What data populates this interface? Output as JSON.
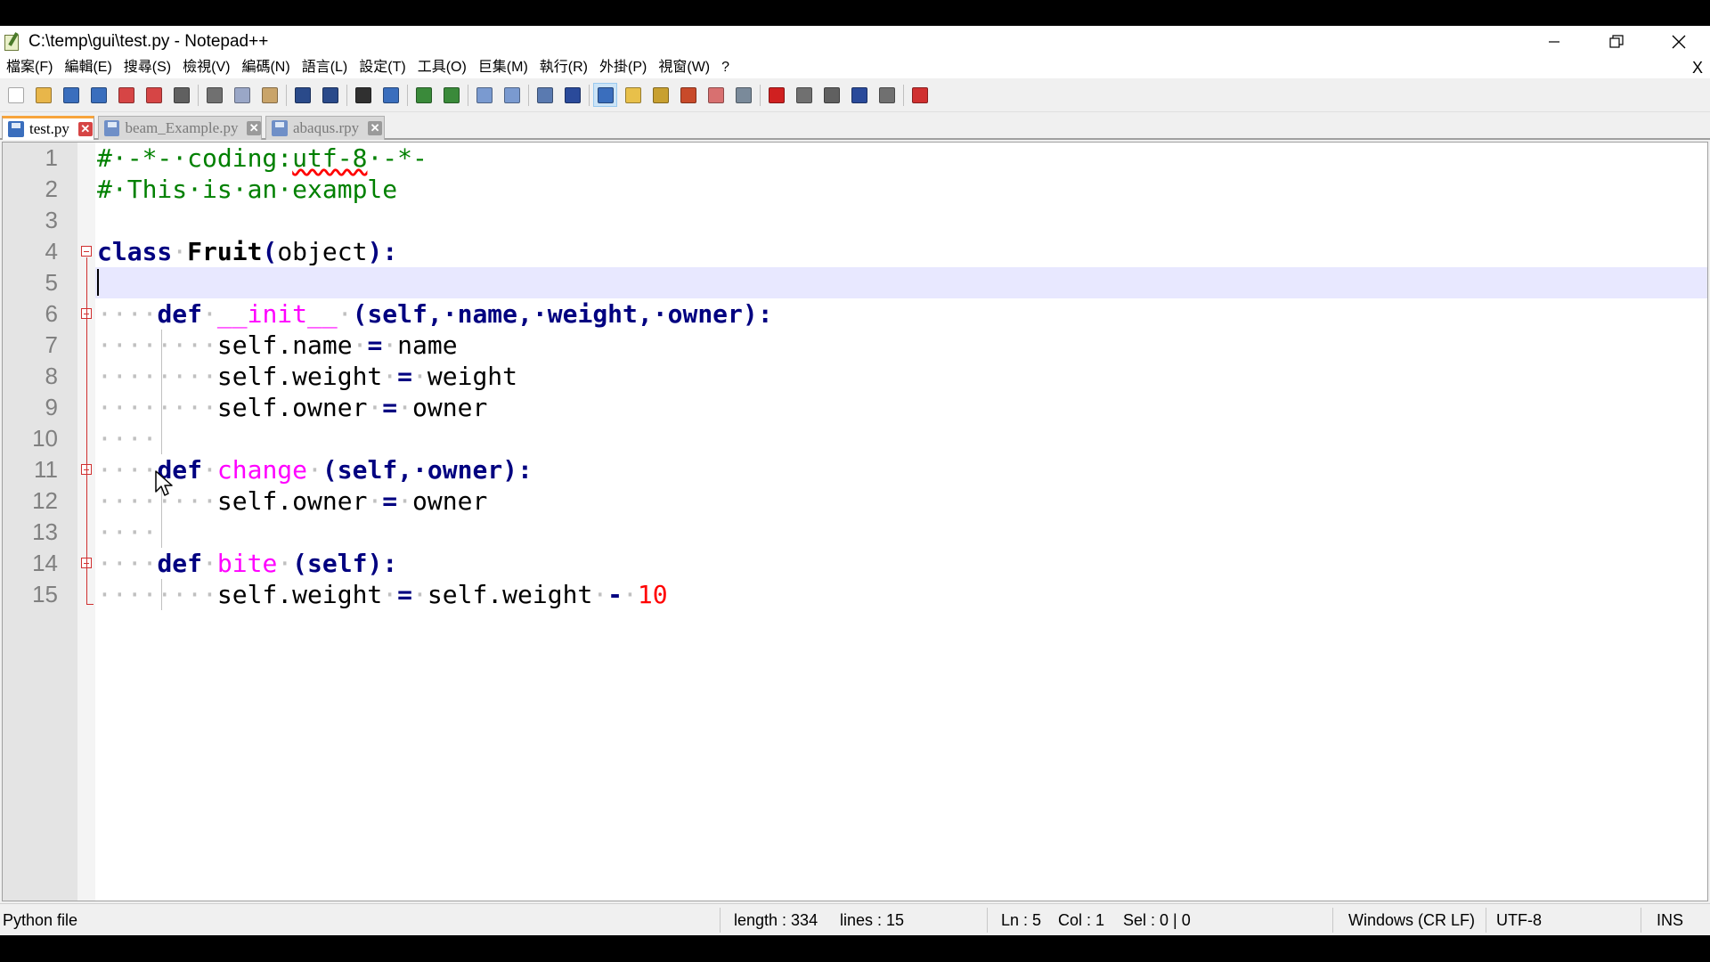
{
  "window": {
    "title": "C:\\temp\\gui\\test.py - Notepad++",
    "controls": [
      "minimize-icon",
      "restore-icon",
      "close-icon"
    ]
  },
  "menu": {
    "items": [
      "檔案(F)",
      "編輯(E)",
      "搜尋(S)",
      "檢視(V)",
      "編碼(N)",
      "語言(L)",
      "設定(T)",
      "工具(O)",
      "巨集(M)",
      "執行(R)",
      "外掛(P)",
      "視窗(W)",
      "?"
    ],
    "close_label": "X"
  },
  "toolbar": {
    "buttons": [
      {
        "icon": "new-file-icon",
        "color": "#ffffff"
      },
      {
        "icon": "open-file-icon",
        "color": "#e8b64a"
      },
      {
        "icon": "save-icon",
        "color": "#3a6ebd"
      },
      {
        "icon": "save-all-icon",
        "color": "#3a6ebd"
      },
      {
        "icon": "close-file-icon",
        "color": "#d64545"
      },
      {
        "icon": "close-all-icon",
        "color": "#d64545"
      },
      {
        "icon": "print-icon",
        "color": "#606060"
      },
      {
        "icon": "cut-icon",
        "color": "#707070"
      },
      {
        "icon": "copy-icon",
        "color": "#9aa7c7"
      },
      {
        "icon": "paste-icon",
        "color": "#c9a46a"
      },
      {
        "icon": "undo-icon",
        "color": "#2a4a8a"
      },
      {
        "icon": "redo-icon",
        "color": "#2a4a8a"
      },
      {
        "icon": "find-icon",
        "color": "#303030"
      },
      {
        "icon": "replace-icon",
        "color": "#3a6ebd"
      },
      {
        "icon": "zoom-in-icon",
        "color": "#3a8a3a"
      },
      {
        "icon": "zoom-out-icon",
        "color": "#3a8a3a"
      },
      {
        "icon": "sync-vertical-icon",
        "color": "#7a9ad0"
      },
      {
        "icon": "sync-horizontal-icon",
        "color": "#7a9ad0"
      },
      {
        "icon": "word-wrap-icon",
        "color": "#5a7ab0"
      },
      {
        "icon": "show-all-chars-icon",
        "color": "#2a4a9a"
      },
      {
        "icon": "indent-guide-icon",
        "color": "#3a6ebd"
      },
      {
        "icon": "user-lang-icon",
        "color": "#e8c04a"
      },
      {
        "icon": "doc-map-icon",
        "color": "#c8a030"
      },
      {
        "icon": "function-list-icon",
        "color": "#c84a2a"
      },
      {
        "icon": "folder-workspace-icon",
        "color": "#d87070"
      },
      {
        "icon": "monitoring-icon",
        "color": "#7a8a9a"
      },
      {
        "icon": "record-macro-icon",
        "color": "#d02020"
      },
      {
        "icon": "stop-macro-icon",
        "color": "#707070"
      },
      {
        "icon": "play-macro-icon",
        "color": "#606060"
      },
      {
        "icon": "run-macro-multiple-icon",
        "color": "#2a4a9a"
      },
      {
        "icon": "save-macro-icon",
        "color": "#707070"
      },
      {
        "icon": "spell-check-icon",
        "color": "#d03030"
      }
    ]
  },
  "tabs": [
    {
      "label": "test.py",
      "active": true
    },
    {
      "label": "beam_Example.py",
      "active": false
    },
    {
      "label": "abaqus.rpy",
      "active": false
    }
  ],
  "editor": {
    "current_line": 5,
    "lines": [
      {
        "n": "1",
        "fold": "none"
      },
      {
        "n": "2",
        "fold": "none"
      },
      {
        "n": "3",
        "fold": "none"
      },
      {
        "n": "4",
        "fold": "start"
      },
      {
        "n": "5",
        "fold": "body"
      },
      {
        "n": "6",
        "fold": "start"
      },
      {
        "n": "7",
        "fold": "body"
      },
      {
        "n": "8",
        "fold": "body"
      },
      {
        "n": "9",
        "fold": "body"
      },
      {
        "n": "10",
        "fold": "body"
      },
      {
        "n": "11",
        "fold": "start"
      },
      {
        "n": "12",
        "fold": "body"
      },
      {
        "n": "13",
        "fold": "body"
      },
      {
        "n": "14",
        "fold": "start"
      },
      {
        "n": "15",
        "fold": "end"
      }
    ],
    "code": {
      "l1_hash": "#",
      "l1_text": "-*-·coding:",
      "l1_enc": "utf-8",
      "l1_tail": "·-*-",
      "l2": "#·This·is·an·example",
      "l4_kw": "class",
      "l4_name": "Fruit",
      "l4_paren": "(",
      "l4_base": "object",
      "l4_tail": "):",
      "l6_ws": "····",
      "l6_kw": "def",
      "l6_name": "__init__",
      "l6_args": "(self,·name,·weight,·owner):",
      "l7_ws": "········",
      "l7_a": "self.name",
      "l7_eq": "=",
      "l7_b": "name",
      "l8_ws": "········",
      "l8_a": "self.weight",
      "l8_eq": "=",
      "l8_b": "weight",
      "l9_ws": "········",
      "l9_a": "self.owner",
      "l9_eq": "=",
      "l9_b": "owner",
      "l10_ws": "····",
      "l11_ws": "····",
      "l11_kw": "def",
      "l11_name": "change",
      "l11_args": "(self,·owner):",
      "l12_ws": "········",
      "l12_a": "self.owner",
      "l12_eq": "=",
      "l12_b": "owner",
      "l13_ws": "····",
      "l14_ws": "····",
      "l14_kw": "def",
      "l14_name": "bite",
      "l14_args": "(self):",
      "l15_ws": "········",
      "l15_a": "self.weight",
      "l15_eq": "=",
      "l15_b": "self.weight",
      "l15_minus": "-",
      "l15_num": "10"
    }
  },
  "status": {
    "file_type": "Python file",
    "length": "length : 334",
    "lines": "lines : 15",
    "ln": "Ln : 5",
    "col": "Col : 1",
    "sel": "Sel : 0 | 0",
    "eol": "Windows (CR LF)",
    "encoding": "UTF-8",
    "mode": "INS"
  }
}
